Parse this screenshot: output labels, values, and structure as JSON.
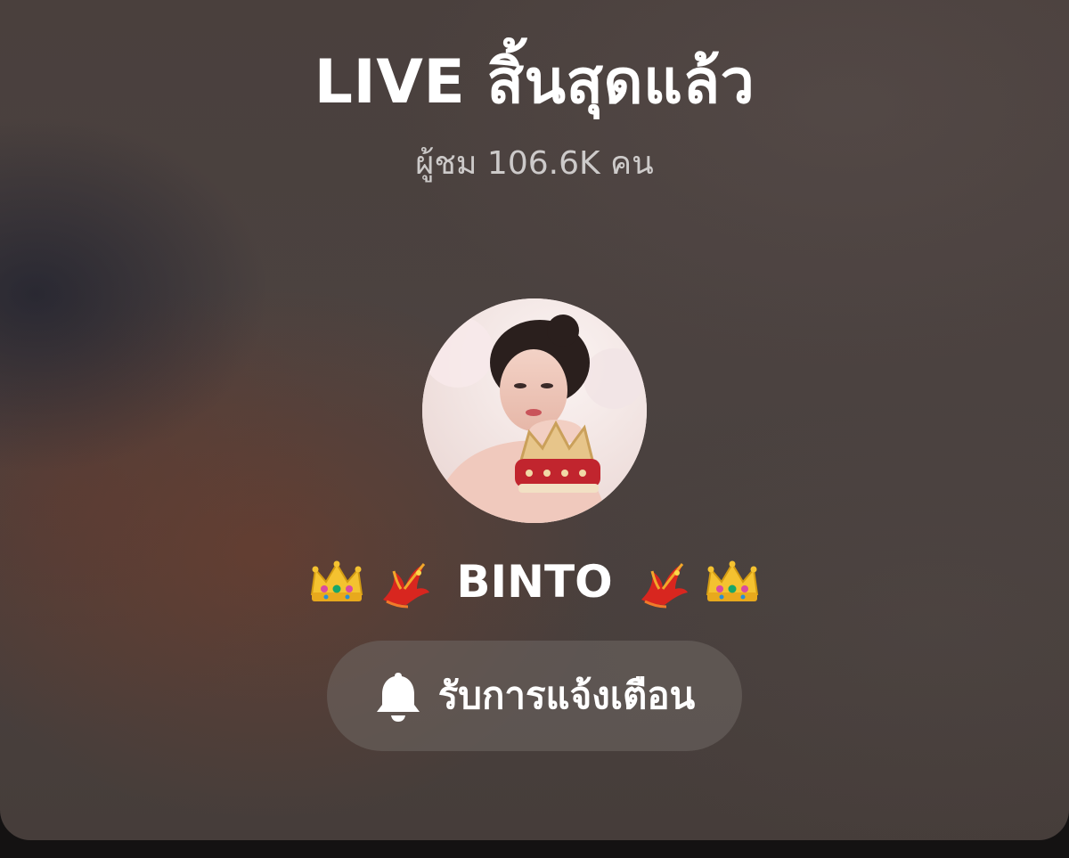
{
  "live_ended": {
    "title": "LIVE สิ้นสุดแล้ว",
    "viewers_text": "ผู้ชม 106.6K คน"
  },
  "host": {
    "avatar_icon": "host-avatar-photo",
    "name": "BINTO",
    "decorations": [
      "crown-emoji",
      "phoenix-emoji",
      "phoenix-emoji",
      "crown-emoji"
    ]
  },
  "notify_button": {
    "icon": "bell-icon",
    "label": "รับการแจ้งเตือน"
  }
}
